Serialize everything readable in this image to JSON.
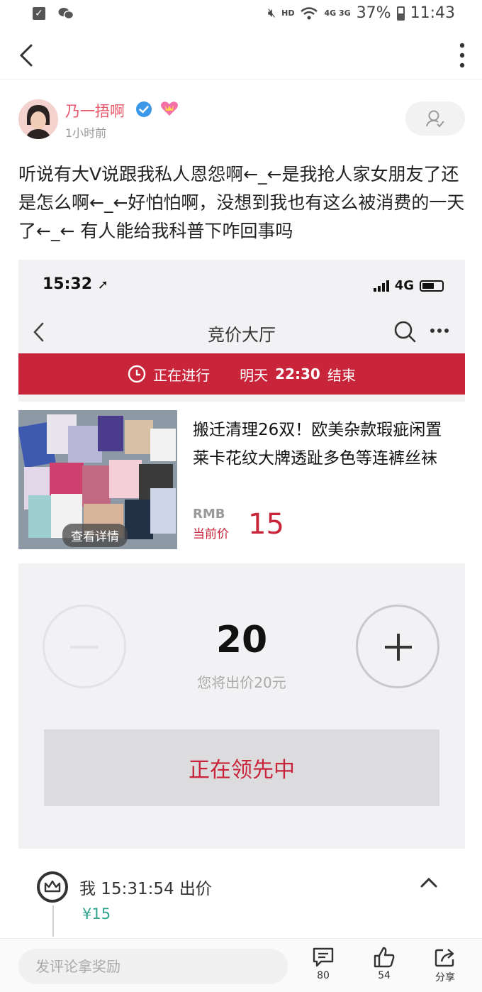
{
  "status_bar": {
    "network": "HD",
    "signal": "4G 3G",
    "battery": "37%",
    "time": "11:43"
  },
  "post": {
    "username": "乃一捂啊",
    "time_ago": "1小时前",
    "text": "听说有大V说跟我私人恩怨啊←_←是我抢人家女朋友了还是怎么啊←_←好怕怕啊，没想到我也有这么被消费的一天了←_← 有人能给我科普下咋回事吗"
  },
  "screenshot": {
    "time": "15:32",
    "network": "4G",
    "title": "竞价大厅",
    "banner": {
      "status": "正在进行",
      "day": "明天",
      "clock": "22:30",
      "end": "结束"
    },
    "product": {
      "detail_label": "查看详情",
      "title": "搬迁清理26双！欧美杂款瑕疵闲置莱卡花纹大牌透趾多色等连裤丝袜",
      "currency": "RMB",
      "price_label": "当前价",
      "price": "15"
    },
    "bid_value": "20",
    "bid_hint": "您将出价20元",
    "leading_label": "正在领先中"
  },
  "bid_record": {
    "text": "我  15:31:54 出价",
    "amount": "¥15"
  },
  "bottom_bar": {
    "comment_placeholder": "发评论拿奖励",
    "comments": "80",
    "likes": "54",
    "share": "分享"
  }
}
